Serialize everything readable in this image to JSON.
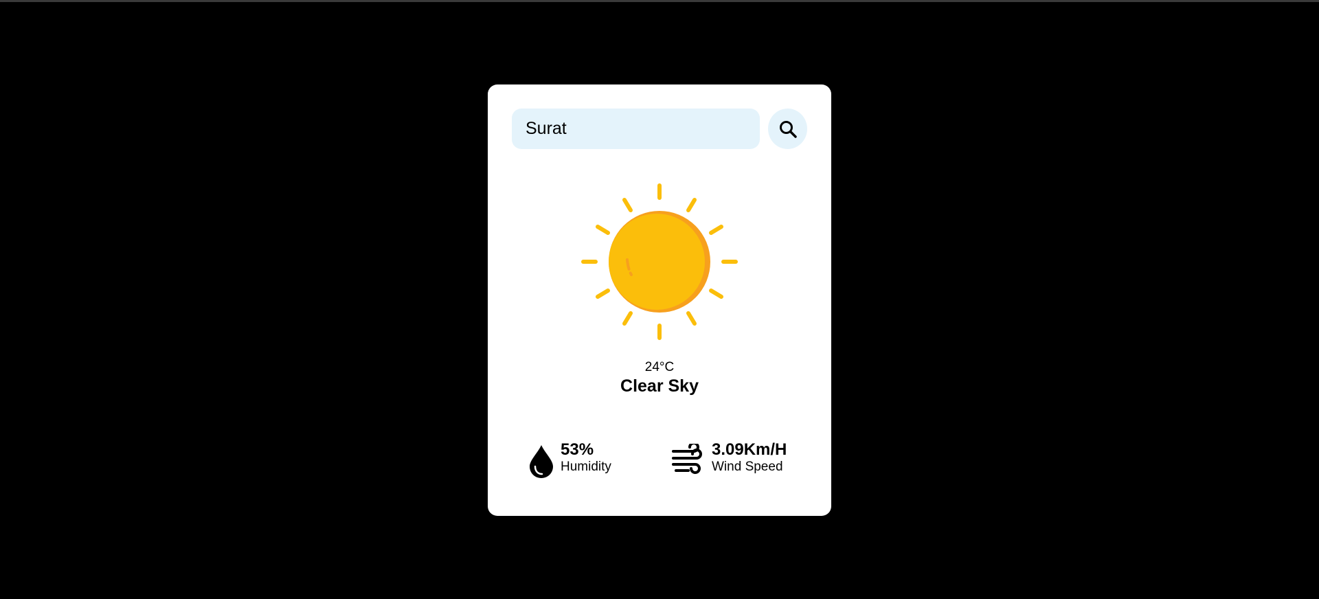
{
  "search": {
    "value": "Surat",
    "placeholder": "",
    "button_icon": "search-icon"
  },
  "weather": {
    "icon": "sun-icon",
    "temperature": "24°C",
    "condition": "Clear Sky"
  },
  "stats": {
    "humidity": {
      "icon": "water-drop-icon",
      "value": "53%",
      "label": "Humidity"
    },
    "wind": {
      "icon": "wind-icon",
      "value": "3.09Km/H",
      "label": "Wind Speed"
    }
  },
  "colors": {
    "background": "#000000",
    "card": "#ffffff",
    "input_bg": "#e4f3fb",
    "sun_main": "#fbbe0b",
    "sun_shade": "#f7a01e"
  }
}
